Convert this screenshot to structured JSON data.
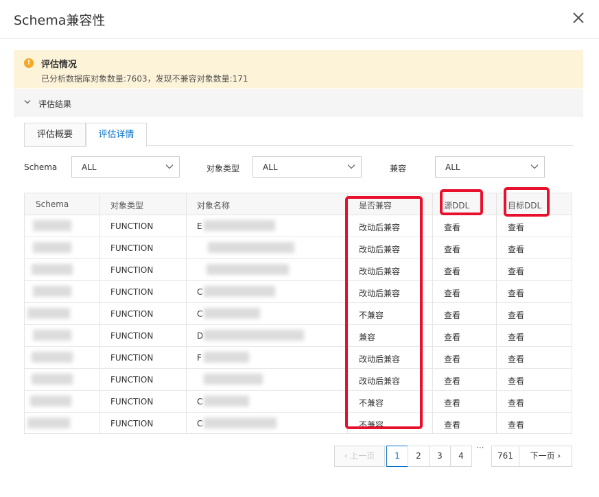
{
  "dialog": {
    "title": "Schema兼容性"
  },
  "alert": {
    "title": "评估情况",
    "description": "已分析数据库对象数量:7603，发现不兼容对象数量:171"
  },
  "collapse": {
    "label": "评估结果"
  },
  "tabs": [
    {
      "label": "评估概要"
    },
    {
      "label": "评估详情"
    }
  ],
  "filters": {
    "schema": {
      "label": "Schema",
      "value": "ALL"
    },
    "object_type": {
      "label": "对象类型",
      "value": "ALL"
    },
    "compatible": {
      "label": "兼容",
      "value": "ALL"
    }
  },
  "table": {
    "headers": [
      "Schema",
      "对象类型",
      "对象名称",
      "是否兼容",
      "源DDL",
      "目标DDL"
    ],
    "rows": [
      {
        "type": "FUNCTION",
        "name_prefix": "E",
        "compat": "改动后兼容",
        "src": "查看",
        "dst": "查看"
      },
      {
        "type": "FUNCTION",
        "name_prefix": "",
        "compat": "改动后兼容",
        "src": "查看",
        "dst": "查看"
      },
      {
        "type": "FUNCTION",
        "name_prefix": "",
        "compat": "改动后兼容",
        "src": "查看",
        "dst": "查看"
      },
      {
        "type": "FUNCTION",
        "name_prefix": "C",
        "compat": "改动后兼容",
        "src": "查看",
        "dst": "查看"
      },
      {
        "type": "FUNCTION",
        "name_prefix": "C",
        "compat": "不兼容",
        "src": "查看",
        "dst": "查看"
      },
      {
        "type": "FUNCTION",
        "name_prefix": "D",
        "compat": "兼容",
        "src": "查看",
        "dst": "查看"
      },
      {
        "type": "FUNCTION",
        "name_prefix": "F",
        "compat": "改动后兼容",
        "src": "查看",
        "dst": "查看"
      },
      {
        "type": "FUNCTION",
        "name_prefix": "",
        "compat": "改动后兼容",
        "src": "查看",
        "dst": "查看"
      },
      {
        "type": "FUNCTION",
        "name_prefix": "C",
        "compat": "不兼容",
        "src": "查看",
        "dst": "查看"
      },
      {
        "type": "FUNCTION",
        "name_prefix": "C",
        "compat": "不兼容",
        "src": "查看",
        "dst": "查看"
      }
    ]
  },
  "pagination": {
    "prev": "上一页",
    "next": "下一页",
    "pages": [
      "1",
      "2",
      "3",
      "4"
    ],
    "ellipsis": "···",
    "last": "761"
  },
  "colors": {
    "accent": "#0070cc",
    "highlight": "#e8112d",
    "alert_bg": "#fdf3d8"
  }
}
